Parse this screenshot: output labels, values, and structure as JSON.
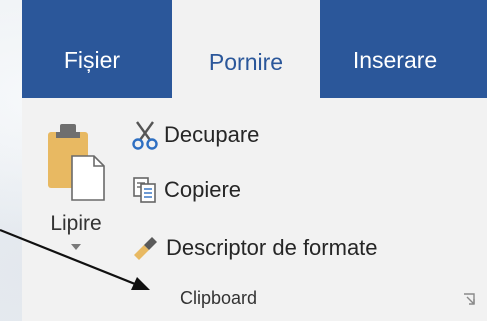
{
  "ribbon": {
    "tabs": [
      {
        "label": "Fișier",
        "active": false
      },
      {
        "label": "Pornire",
        "active": true
      },
      {
        "label": "Inserare",
        "active": false
      }
    ],
    "tab_color": "#2b579a",
    "clipboard_group": {
      "paste_label": "Lipire",
      "commands": [
        {
          "label": "Decupare",
          "icon": "scissors-icon"
        },
        {
          "label": "Copiere",
          "icon": "copy-icon"
        },
        {
          "label": "Descriptor de formate",
          "icon": "format-painter-icon"
        }
      ],
      "group_label": "Clipboard"
    }
  }
}
